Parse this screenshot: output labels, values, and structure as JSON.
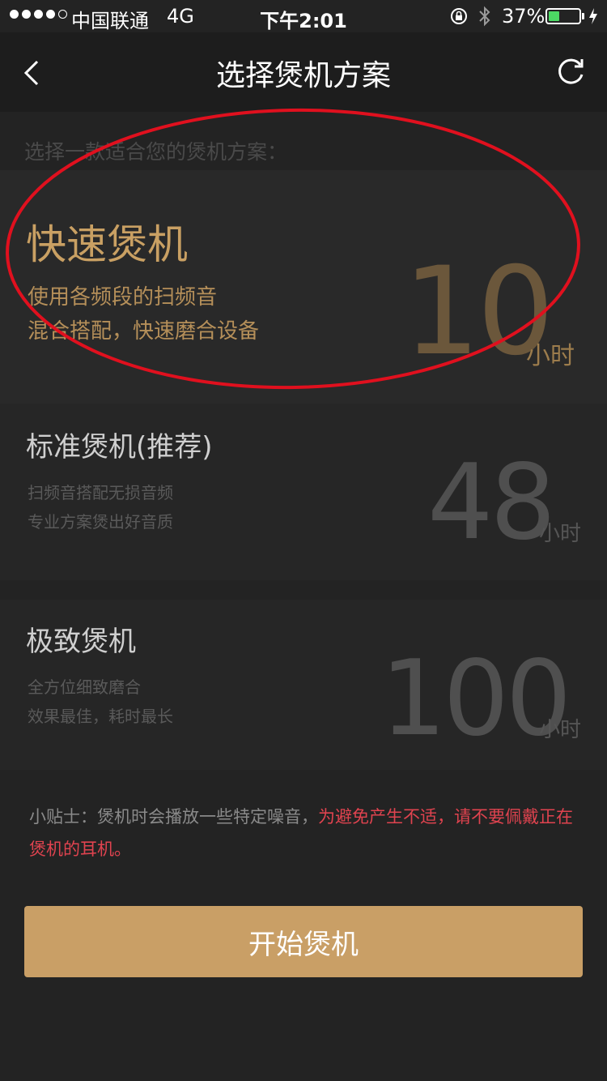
{
  "status_bar": {
    "carrier": "中国联通",
    "network": "4G",
    "time": "下午2:01",
    "battery_percent_label": "37%",
    "battery_level": 0.37,
    "battery_color": "#4cd964"
  },
  "nav": {
    "title": "选择煲机方案",
    "back_icon": "chevron-left-icon",
    "refresh_icon": "refresh-icon"
  },
  "prompt": "选择一款适合您的煲机方案：",
  "plans": [
    {
      "title": "快速煲机",
      "desc": [
        "使用各频段的扫频音",
        "混合搭配，快速磨合设备"
      ],
      "hours": "10",
      "unit": "小时",
      "selected": true
    },
    {
      "title": "标准煲机(推荐)",
      "desc": [
        "扫频音搭配无损音频",
        "专业方案煲出好音质"
      ],
      "hours": "48",
      "unit": "小时",
      "selected": false
    },
    {
      "title": "极致煲机",
      "desc": [
        "全方位细致磨合",
        "效果最佳，耗时最长"
      ],
      "hours": "100",
      "unit": "小时",
      "selected": false
    }
  ],
  "tip": {
    "prefix": "小贴士：煲机时会播放一些特定噪音，",
    "warning": "为避免产生不适，请不要佩戴正在煲机的耳机。"
  },
  "start_button": "开始煲机",
  "colors": {
    "accent": "#c99f66",
    "warning": "#e0434f",
    "annotation": "#e0101e"
  }
}
